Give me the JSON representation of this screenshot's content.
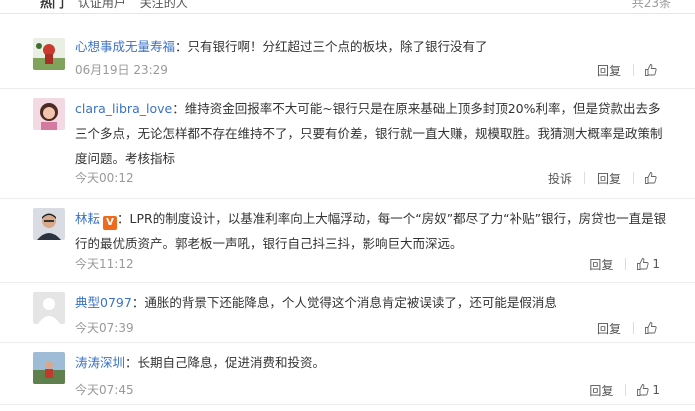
{
  "top_tabs": [
    "热门",
    "认证用户",
    "关注的人"
  ],
  "top_total": "共23条",
  "comments": [
    {
      "user": "心想事成无量寿福",
      "sep": "：",
      "text": "只有银行啊！分红超过三个点的板块，除了银行没有了",
      "time": "06月19日 23:29",
      "reply": "回复",
      "likes": ""
    },
    {
      "user": "clara_libra_love",
      "sep": "：",
      "text": "维持资金回报率不大可能~银行只是在原来基础上顶多封顶20%利率，但是贷款出去多三个多点，无论怎样都不存在维持不了，只要有价差，银行就一直大赚，规模取胜。我猜测大概率是政策制度问题。考核指标",
      "time": "今天00:12",
      "report": "投诉",
      "reply": "回复",
      "likes": ""
    },
    {
      "user": "林耘",
      "badge": "V",
      "sep": "：",
      "text": "LPR的制度设计，以基准利率向上大幅浮动，每一个“房奴”都尽了力“补贴”银行，房贷也一直是银行的最优质资产。郭老板一声吼，银行自己抖三抖，影响巨大而深远。",
      "time": "今天11:12",
      "reply": "回复",
      "likes": "1"
    },
    {
      "user": "典型0797",
      "sep": "：",
      "text": "通胀的背景下还能降息，个人觉得这个消息肯定被误读了，还可能是假消息",
      "time": "今天07:39",
      "reply": "回复",
      "likes": ""
    },
    {
      "user": "涛涛深圳",
      "sep": "：",
      "text": "长期自己降息，促进消费和投资。",
      "time": "今天07:45",
      "reply": "回复",
      "likes": "1"
    }
  ]
}
